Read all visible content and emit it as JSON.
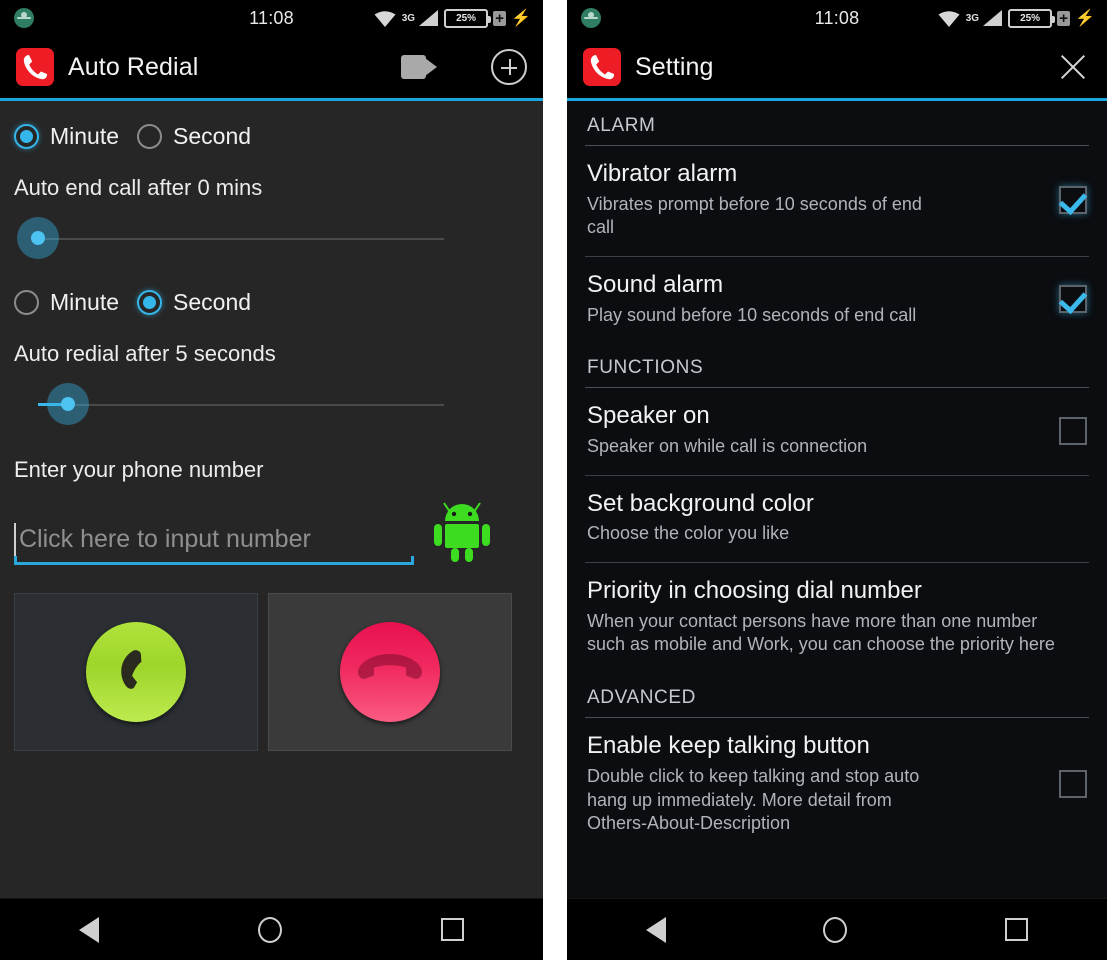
{
  "status_bar": {
    "clock": "11:08",
    "battery_label": "25%",
    "network_label": "3G",
    "icons": [
      "download-icon",
      "wifi-icon",
      "signal-3g-icon",
      "battery-icon",
      "charging-bolt-icon"
    ]
  },
  "left_screen": {
    "app_bar": {
      "title": "Auto Redial",
      "logo_icon": "phone-handset-icon",
      "video_icon": "video-camera-icon",
      "add_icon": "plus-circle-icon"
    },
    "end_call": {
      "unit_minute": "Minute",
      "unit_second": "Second",
      "selected_unit": "Minute",
      "summary": "Auto end call after 0 mins",
      "slider_value": 0,
      "slider_percent": 0
    },
    "redial": {
      "unit_minute": "Minute",
      "unit_second": "Second",
      "selected_unit": "Second",
      "summary": "Auto redial after 5 seconds",
      "slider_value": 5,
      "slider_percent": 4
    },
    "phone_number": {
      "label": "Enter your phone number",
      "value": "",
      "placeholder": "Click here to input number",
      "mascot_icon": "android-robot-icon"
    },
    "actions": {
      "call_label": "call-button",
      "call_icon": "phone-call-icon",
      "hangup_label": "hang-up-button",
      "hangup_icon": "phone-hangup-icon"
    }
  },
  "right_screen": {
    "app_bar": {
      "title": "Setting",
      "logo_icon": "phone-handset-icon",
      "close_icon": "close-x-icon"
    },
    "groups": [
      {
        "header": "ALARM",
        "rows": [
          {
            "title": "Vibrator alarm",
            "subtitle": "Vibrates prompt before 10 seconds of end call",
            "checkbox": true
          },
          {
            "title": "Sound alarm",
            "subtitle": "Play sound before 10 seconds of end call",
            "checkbox": true
          }
        ]
      },
      {
        "header": "FUNCTIONS",
        "rows": [
          {
            "title": "Speaker on",
            "subtitle": "Speaker on while call is connection",
            "checkbox": false
          },
          {
            "title": "Set background color",
            "subtitle": "Choose the color you like",
            "checkbox": null
          },
          {
            "title": "Priority in choosing dial number",
            "subtitle": "When your contact persons have more than one number such as mobile and Work, you can choose the priority here",
            "checkbox": null
          }
        ]
      },
      {
        "header": "ADVANCED",
        "rows": [
          {
            "title": "Enable keep talking button",
            "subtitle": "Double click to keep talking and stop auto hang up immediately. More detail from Others-About-Description",
            "checkbox": false
          }
        ]
      }
    ]
  },
  "nav_bar": {
    "back": "back-icon",
    "home": "home-icon",
    "recents": "recents-icon"
  },
  "colors": {
    "accent": "#35b6ea",
    "brand_red": "#ee1c25",
    "call_green": "#9ed62b",
    "hangup_red": "#f0295f",
    "android_green": "#3ddc21"
  }
}
